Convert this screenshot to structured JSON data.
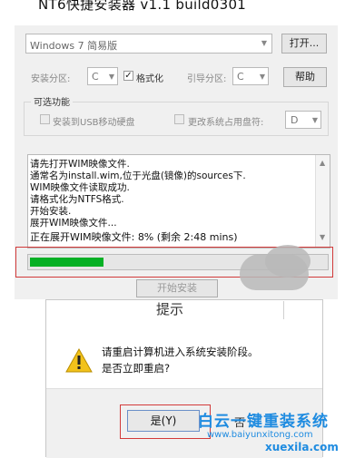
{
  "installer": {
    "title": "NT6快捷安装器 v1.1 build0301",
    "os_select": {
      "value": "Windows 7 简易版"
    },
    "open_button": "打开...",
    "install_partition_label": "安装分区:",
    "install_partition_value": "C",
    "format_label": "格式化",
    "format_checked": true,
    "boot_partition_label": "引导分区:",
    "boot_partition_value": "C",
    "help_button": "帮助",
    "optional_group_title": "可选功能",
    "usb_option_label": "安装到USB移动硬盘",
    "drive_letter_option_label": "更改系统占用盘符:",
    "drive_letter_value": "D",
    "log_lines": [
      "请先打开WIM映像文件.",
      "通常名为install.wim,位于光盘(镜像)的sources下.",
      "WIM映像文件读取成功.",
      "请格式化为NTFS格式.",
      "开始安装.",
      "展开WIM映像文件...",
      "正在展开WIM映像文件:  8% (剩余 2:48 mins)"
    ],
    "progress": 0.08,
    "start_button": "开始安装"
  },
  "dialog": {
    "title": "提示",
    "message_line1": "请重启计算机进入系统安装阶段。",
    "message_line2": "是否立即重启?",
    "yes_button": "是(Y)",
    "no_button": "否"
  },
  "watermark": {
    "brand": "白云一键重装系统",
    "url": "www.baiyunxitong.com",
    "url2": "xuexila.com"
  },
  "colors": {
    "progress_fill": "#06b025",
    "highlight_outline": "#d23a3a",
    "watermark": "#1e8be0"
  }
}
